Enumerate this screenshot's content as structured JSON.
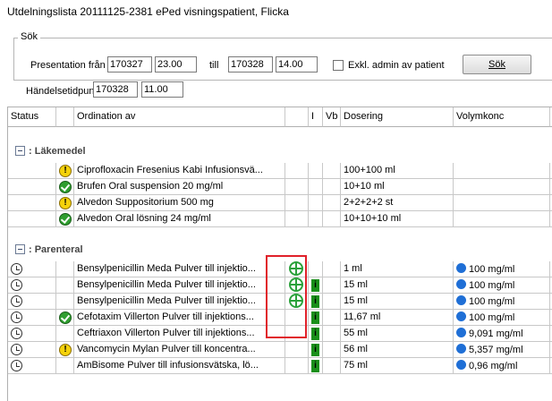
{
  "window": {
    "title": "Utdelningslista  20111125-2381 ePed visningspatient, Flicka"
  },
  "search": {
    "group_label": "Sök",
    "presentation_label": "Presentation från",
    "from_date": "170327",
    "from_time": "23.00",
    "till_label": "till",
    "to_date": "170328",
    "to_time": "14.00",
    "exclude_label": "Exkl. admin av patient",
    "search_button": "Sök",
    "event_label": "Händelsetidpunkt",
    "event_date": "170328",
    "event_time": "11.00"
  },
  "columns": {
    "status": "Status",
    "ordination": "Ordination av",
    "i": "I",
    "vb": "Vb",
    "dosering": "Dosering",
    "volymkonc": "Volymkonc"
  },
  "groups": [
    {
      "name": ": Läkemedel",
      "rows": [
        {
          "status": "",
          "flag": "warn",
          "name": "Ciprofloxacin Fresenius Kabi Infusionsvä...",
          "icon": "",
          "info": "",
          "dose": "100+100 ml",
          "conc": "",
          "extra": "i"
        },
        {
          "status": "",
          "flag": "ok",
          "name": "Brufen Oral suspension 20 mg/ml",
          "icon": "",
          "info": "",
          "dose": "10+10 ml",
          "conc": "",
          "extra": "i"
        },
        {
          "status": "",
          "flag": "warn",
          "name": "Alvedon Suppositorium 500 mg",
          "icon": "",
          "info": "",
          "dose": "2+2+2+2 st",
          "conc": "",
          "extra": "i"
        },
        {
          "status": "",
          "flag": "ok",
          "name": "Alvedon Oral lösning 24 mg/ml",
          "icon": "",
          "info": "",
          "dose": "10+10+10 ml",
          "conc": "",
          "extra": "i"
        }
      ]
    },
    {
      "name": ": Parenteral",
      "rows": [
        {
          "status": "clock",
          "flag": "",
          "name": "Bensylpenicillin Meda Pulver till injektio...",
          "icon": "cross",
          "info": "",
          "dose": "1 ml",
          "conc": "100 mg/ml",
          "extra": "i"
        },
        {
          "status": "clock",
          "flag": "",
          "name": "Bensylpenicillin Meda Pulver till injektio...",
          "icon": "cross",
          "info": "i",
          "dose": "15 ml",
          "conc": "100 mg/ml",
          "extra": "i"
        },
        {
          "status": "clock",
          "flag": "",
          "name": "Bensylpenicillin Meda Pulver till injektio...",
          "icon": "cross",
          "info": "i",
          "dose": "15 ml",
          "conc": "100 mg/ml",
          "extra": "i"
        },
        {
          "status": "clock",
          "flag": "ok",
          "name": "Cefotaxim Villerton Pulver till injektions...",
          "icon": "",
          "info": "i",
          "dose": "11,67 ml",
          "conc": "100 mg/ml",
          "extra": "i"
        },
        {
          "status": "clock",
          "flag": "",
          "name": "Ceftriaxon Villerton Pulver till injektions...",
          "icon": "",
          "info": "i",
          "dose": "55 ml",
          "conc": "9,091 mg/ml",
          "extra": "i"
        },
        {
          "status": "clock",
          "flag": "warn",
          "name": "Vancomycin Mylan Pulver till koncentra...",
          "icon": "",
          "info": "i",
          "dose": "56 ml",
          "conc": "5,357 mg/ml",
          "extra": "i"
        },
        {
          "status": "clock",
          "flag": "",
          "name": "AmBisome Pulver till infusionsvätska, lö...",
          "icon": "",
          "info": "i",
          "dose": "75 ml",
          "conc": "0,96 mg/ml",
          "extra": "i"
        }
      ]
    }
  ]
}
